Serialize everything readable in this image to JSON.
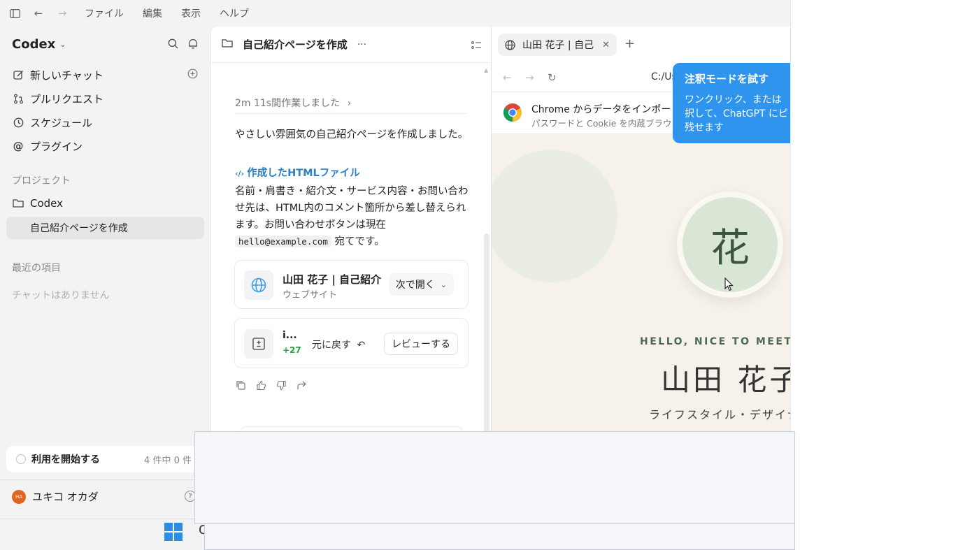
{
  "menubar": {
    "items": [
      "ファイル",
      "編集",
      "表示",
      "ヘルプ"
    ]
  },
  "sidebar": {
    "brand": "Codex",
    "nav": [
      {
        "label": "新しいチャット",
        "icon": "compose-icon"
      },
      {
        "label": "プルリクエスト",
        "icon": "pull-request-icon"
      },
      {
        "label": "スケジュール",
        "icon": "clock-icon"
      },
      {
        "label": "プラグイン",
        "icon": "at-icon"
      }
    ],
    "projects_heading": "プロジェクト",
    "project_folder": "Codex",
    "project_chat": "自己紹介ページを作成",
    "recent_heading": "最近の項目",
    "recent_empty": "チャットはありません",
    "get_started": "利用を開始する",
    "get_started_count": "4 件中 0 件",
    "user_name": "ユキコ オカダ",
    "user_initials": "HA",
    "help": "?"
  },
  "chat": {
    "title": "自己紹介ページを作成",
    "more": "···",
    "worked": "2m 11s間作業しました",
    "message1": "やさしい雰囲気の自己紹介ページを作成しました。",
    "file_link": "作成したHTMLファイル",
    "message2_pre": "名前・肩書き・紹介文・サービス内容・お問い合わせ先は、HTML内のコメント箇所から差し替えられます。お問い合わせボタンは現在",
    "email": "hello@example.com",
    "message2_post": "宛てです。",
    "site_card": {
      "name": "山田 花子 | 自己紹介",
      "type": "ウェブサイト",
      "open": "次で開く"
    },
    "diff_card": {
      "file": "i...",
      "diff": "+27",
      "revert": "元に戻す",
      "review": "レビューする"
    }
  },
  "browser": {
    "tab_title": "山田 花子 | 自己",
    "url": "C:/Us",
    "import_title": "Chrome からデータをインポート",
    "import_sub": "パスワードと Cookie を内蔵ブラウ",
    "portrait_char": "花",
    "hello": "HELLO, NICE TO MEET Y",
    "name": "山田 花子",
    "role": "ライフスタイル・デザイナ"
  },
  "tooltip": {
    "title": "注釈モードを試す",
    "line1": "ワンクリック、または",
    "line2": "択して、ChatGPT にピ",
    "line3": "残せます"
  },
  "taskbar": {
    "char": "C"
  },
  "colors": {
    "accent": "#2e94ee",
    "link": "#2a7fc7",
    "diff_add": "#2f9e44",
    "avatar": "#e0661f"
  }
}
